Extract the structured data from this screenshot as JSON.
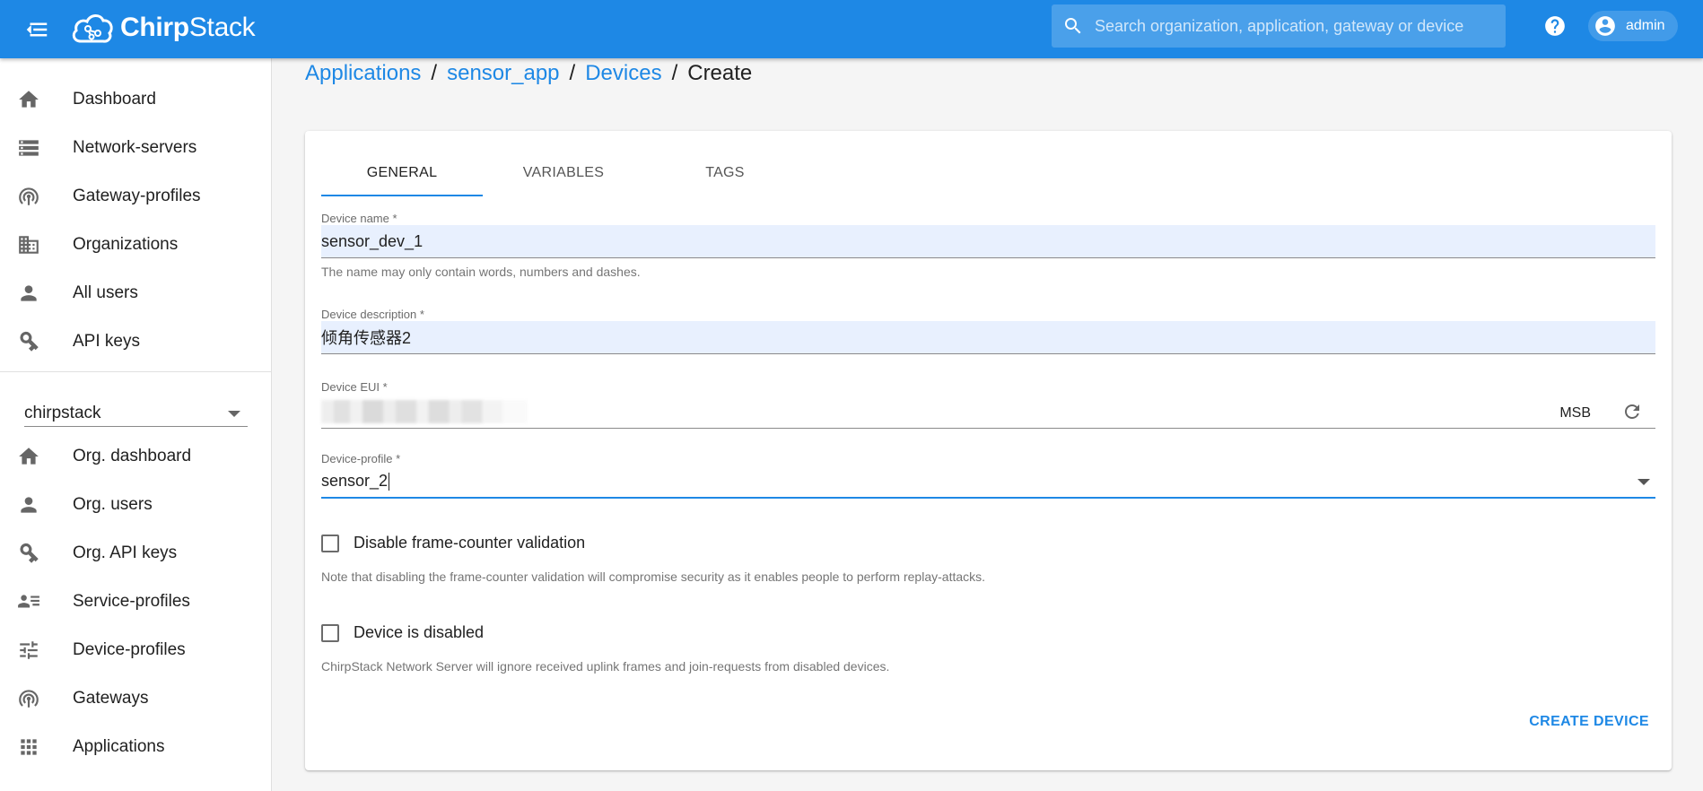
{
  "app": {
    "name_bold": "Chirp",
    "name_rest": "Stack"
  },
  "search": {
    "placeholder": "Search organization, application, gateway or device"
  },
  "user": {
    "name": "admin"
  },
  "sidebar": {
    "global_items": [
      {
        "label": "Dashboard",
        "icon": "home-icon"
      },
      {
        "label": "Network-servers",
        "icon": "servers-icon"
      },
      {
        "label": "Gateway-profiles",
        "icon": "broadcast-icon"
      },
      {
        "label": "Organizations",
        "icon": "domain-icon"
      },
      {
        "label": "All users",
        "icon": "user-icon"
      },
      {
        "label": "API keys",
        "icon": "key-icon"
      }
    ],
    "org_select": {
      "value": "chirpstack"
    },
    "org_items": [
      {
        "label": "Org. dashboard",
        "icon": "home-icon"
      },
      {
        "label": "Org. users",
        "icon": "user-icon"
      },
      {
        "label": "Org. API keys",
        "icon": "key-icon"
      },
      {
        "label": "Service-profiles",
        "icon": "account-details-icon"
      },
      {
        "label": "Device-profiles",
        "icon": "tune-icon"
      },
      {
        "label": "Gateways",
        "icon": "broadcast-icon"
      },
      {
        "label": "Applications",
        "icon": "apps-icon"
      }
    ]
  },
  "breadcrumb": {
    "items": [
      "Applications",
      "sensor_app",
      "Devices"
    ],
    "separator": "/",
    "current": "Create"
  },
  "tabs": [
    "GENERAL",
    "VARIABLES",
    "TAGS"
  ],
  "form": {
    "device_name": {
      "label": "Device name *",
      "value": "sensor_dev_1",
      "helper": "The name may only contain words, numbers and dashes."
    },
    "device_description": {
      "label": "Device description *",
      "value": "倾角传感器2"
    },
    "device_eui": {
      "label": "Device EUI *",
      "byte_order": "MSB"
    },
    "device_profile": {
      "label": "Device-profile *",
      "value": "sensor_2"
    },
    "disable_fcnt": {
      "label": "Disable frame-counter validation",
      "note": "Note that disabling the frame-counter validation will compromise security as it enables people to perform replay-attacks."
    },
    "device_disabled": {
      "label": "Device is disabled",
      "note": "ChirpStack Network Server will ignore received uplink frames and join-requests from disabled devices."
    },
    "submit_label": "CREATE DEVICE"
  },
  "colors": {
    "primary": "#1e88e5",
    "autofill": "#e8f0fe"
  }
}
